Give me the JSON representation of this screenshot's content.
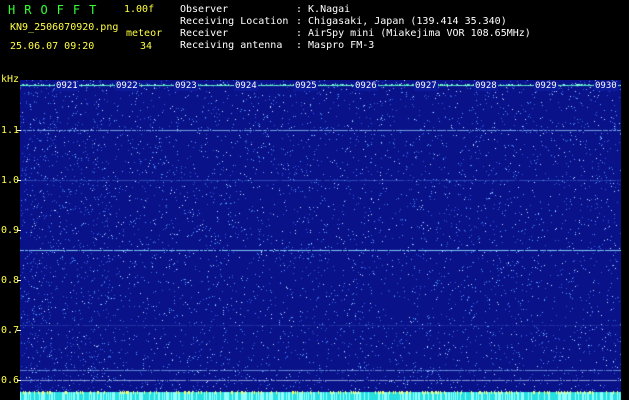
{
  "app": {
    "logo": "HROFFT",
    "version": "1.00f",
    "filename": "KN9_2506070920.png",
    "datetime": "25.06.07 09:20",
    "mode_label": "meteor",
    "count": "34"
  },
  "info": [
    {
      "key": "Observer",
      "value": ": K.Nagai"
    },
    {
      "key": "Receiving Location",
      "value": ": Chigasaki, Japan (139.414 35.340)"
    },
    {
      "key": "Receiver",
      "value": ": AirSpy mini (Miakejima VOR 108.65MHz)"
    },
    {
      "key": "Receiving antenna",
      "value": ": Maspro FM-3"
    }
  ],
  "spectrogram": {
    "y_unit": "kHz",
    "y_ticks": [
      "1.1",
      "1.0",
      "0.9",
      "0.8",
      "0.7",
      "0.6"
    ],
    "x_ticks": [
      "0921",
      "0922",
      "0923",
      "0924",
      "0925",
      "0926",
      "0927",
      "0928",
      "0929",
      "0930"
    ],
    "colors": {
      "background": "#0a128a",
      "noise": "#4aa0ff",
      "signal": "#7fffd4",
      "axis_text": "#ffff44"
    }
  }
}
